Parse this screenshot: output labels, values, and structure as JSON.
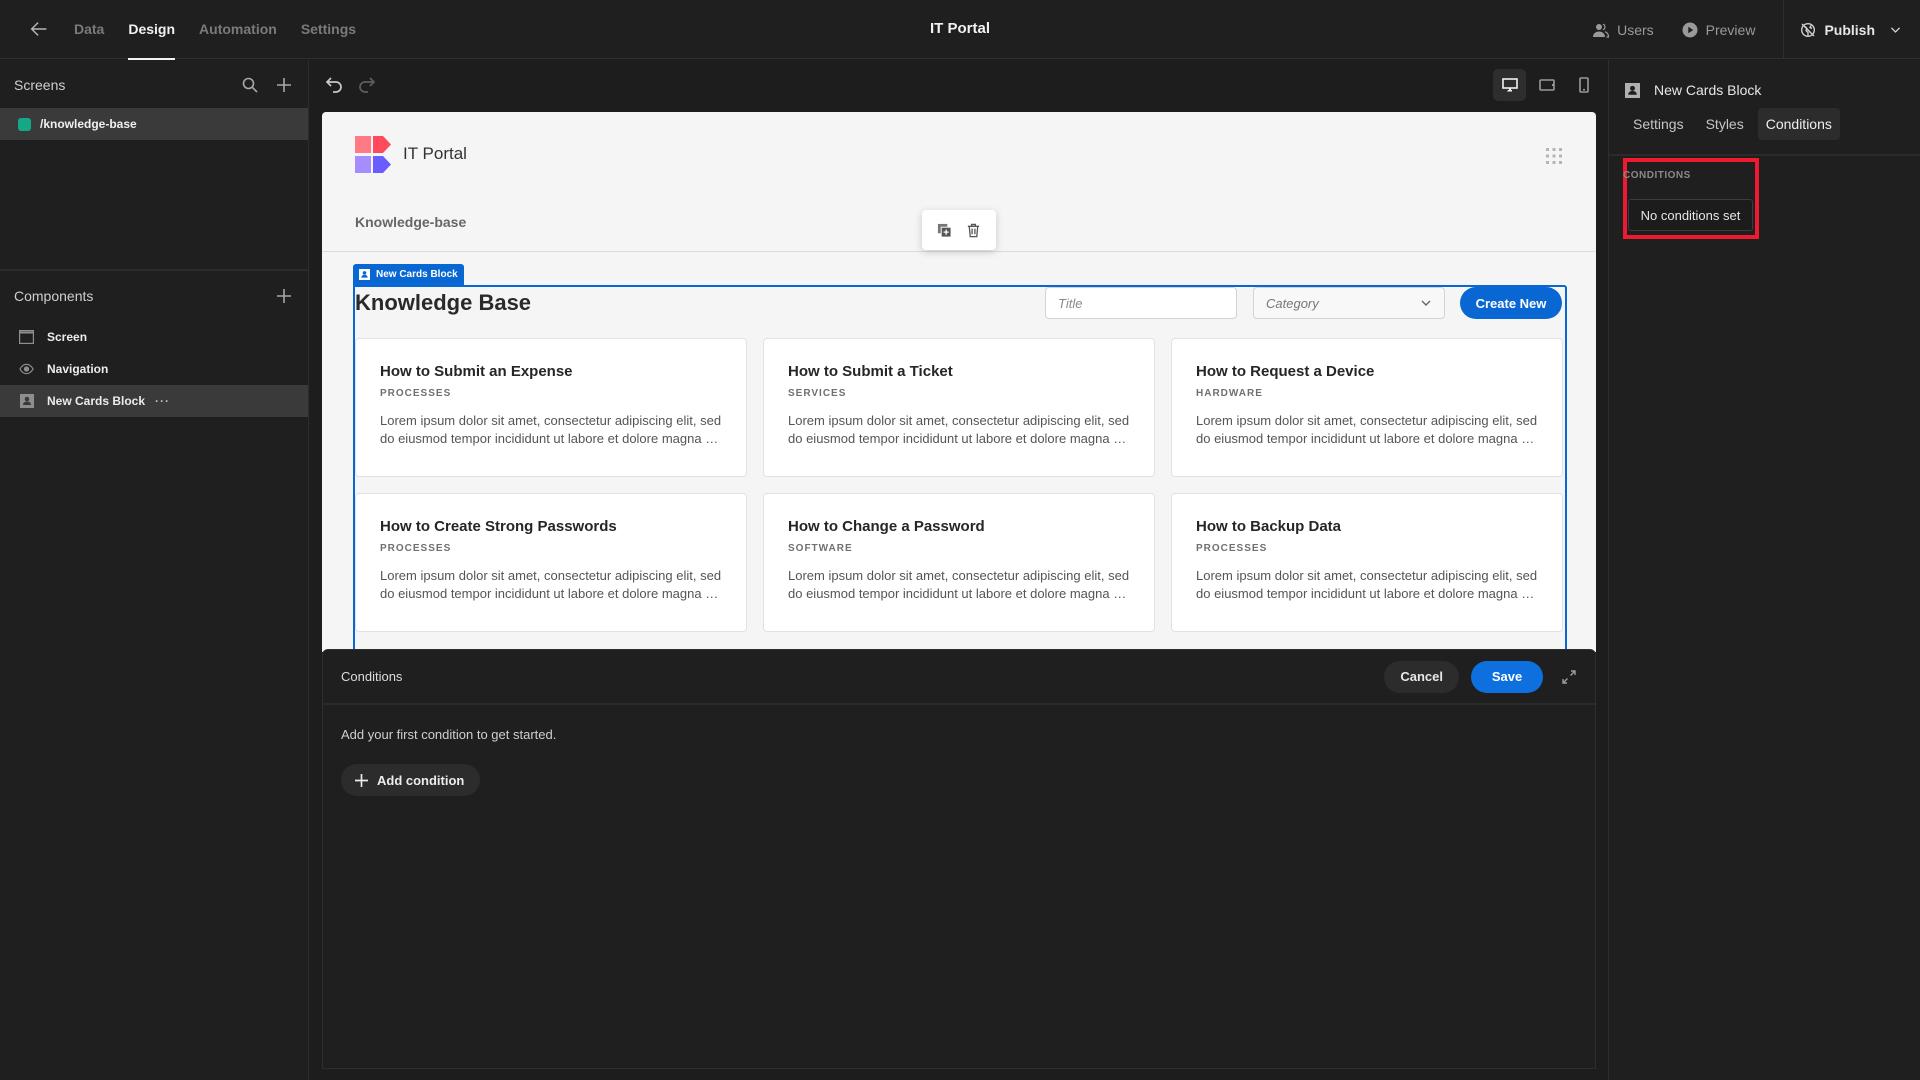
{
  "topbar": {
    "back_icon": "arrow-left-icon",
    "tabs": [
      {
        "label": "Data",
        "active": false
      },
      {
        "label": "Design",
        "active": true
      },
      {
        "label": "Automation",
        "active": false
      },
      {
        "label": "Settings",
        "active": false
      }
    ],
    "app_title": "IT Portal",
    "users_label": "Users",
    "preview_label": "Preview",
    "publish_label": "Publish"
  },
  "left_panel": {
    "screens_heading": "Screens",
    "screens": [
      {
        "route": "/knowledge-base",
        "color": "#14a887",
        "selected": true
      }
    ],
    "components_heading": "Components",
    "components": [
      {
        "label": "Screen",
        "icon": "screen-icon",
        "selected": false
      },
      {
        "label": "Navigation",
        "icon": "eye-icon",
        "selected": false
      },
      {
        "label": "New Cards Block",
        "icon": "cards-block-icon",
        "selected": true,
        "more": "···"
      }
    ]
  },
  "toolbar": {
    "devices": [
      {
        "name": "desktop",
        "active": true
      },
      {
        "name": "tablet",
        "active": false
      },
      {
        "name": "mobile",
        "active": false
      }
    ]
  },
  "preview": {
    "logo_title": "IT Portal",
    "nav_link": "Knowledge-base",
    "block_tag": "New Cards Block",
    "heading": "Knowledge Base",
    "title_placeholder": "Title",
    "category_placeholder": "Category",
    "create_label": "Create New",
    "cards": [
      {
        "title": "How to Submit an Expense",
        "category": "PROCESSES",
        "description": "Lorem ipsum dolor sit amet, consectetur adipiscing elit, sed do eiusmod tempor incididunt ut labore et dolore magna aliqua."
      },
      {
        "title": "How to Submit a Ticket",
        "category": "SERVICES",
        "description": "Lorem ipsum dolor sit amet, consectetur adipiscing elit, sed do eiusmod tempor incididunt ut labore et dolore magna aliqua."
      },
      {
        "title": "How to Request a Device",
        "category": "HARDWARE",
        "description": "Lorem ipsum dolor sit amet, consectetur adipiscing elit, sed do eiusmod tempor incididunt ut labore et dolore magna aliqua."
      },
      {
        "title": "How to Create Strong Passwords",
        "category": "PROCESSES",
        "description": "Lorem ipsum dolor sit amet, consectetur adipiscing elit, sed do eiusmod tempor incididunt ut labore et dolore magna aliqua."
      },
      {
        "title": "How to Change a Password",
        "category": "SOFTWARE",
        "description": "Lorem ipsum dolor sit amet, consectetur adipiscing elit, sed do eiusmod tempor incididunt ut labore et dolore magna aliqua."
      },
      {
        "title": "How to Backup Data",
        "category": "PROCESSES",
        "description": "Lorem ipsum dolor sit amet, consectetur adipiscing elit, sed do eiusmod tempor incididunt ut labore et dolore magna aliqua."
      }
    ]
  },
  "drawer": {
    "title": "Conditions",
    "cancel_label": "Cancel",
    "save_label": "Save",
    "hint": "Add your first condition to get started.",
    "add_label": "Add condition"
  },
  "right_panel": {
    "component_name": "New Cards Block",
    "tabs": [
      {
        "label": "Settings",
        "active": false
      },
      {
        "label": "Styles",
        "active": false
      },
      {
        "label": "Conditions",
        "active": true
      }
    ],
    "section_label": "CONDITIONS",
    "no_conditions_label": "No conditions set",
    "highlight_color": "#ee1a2f"
  },
  "colors": {
    "accent": "#0867d2",
    "screen_dot": "#14a887"
  }
}
